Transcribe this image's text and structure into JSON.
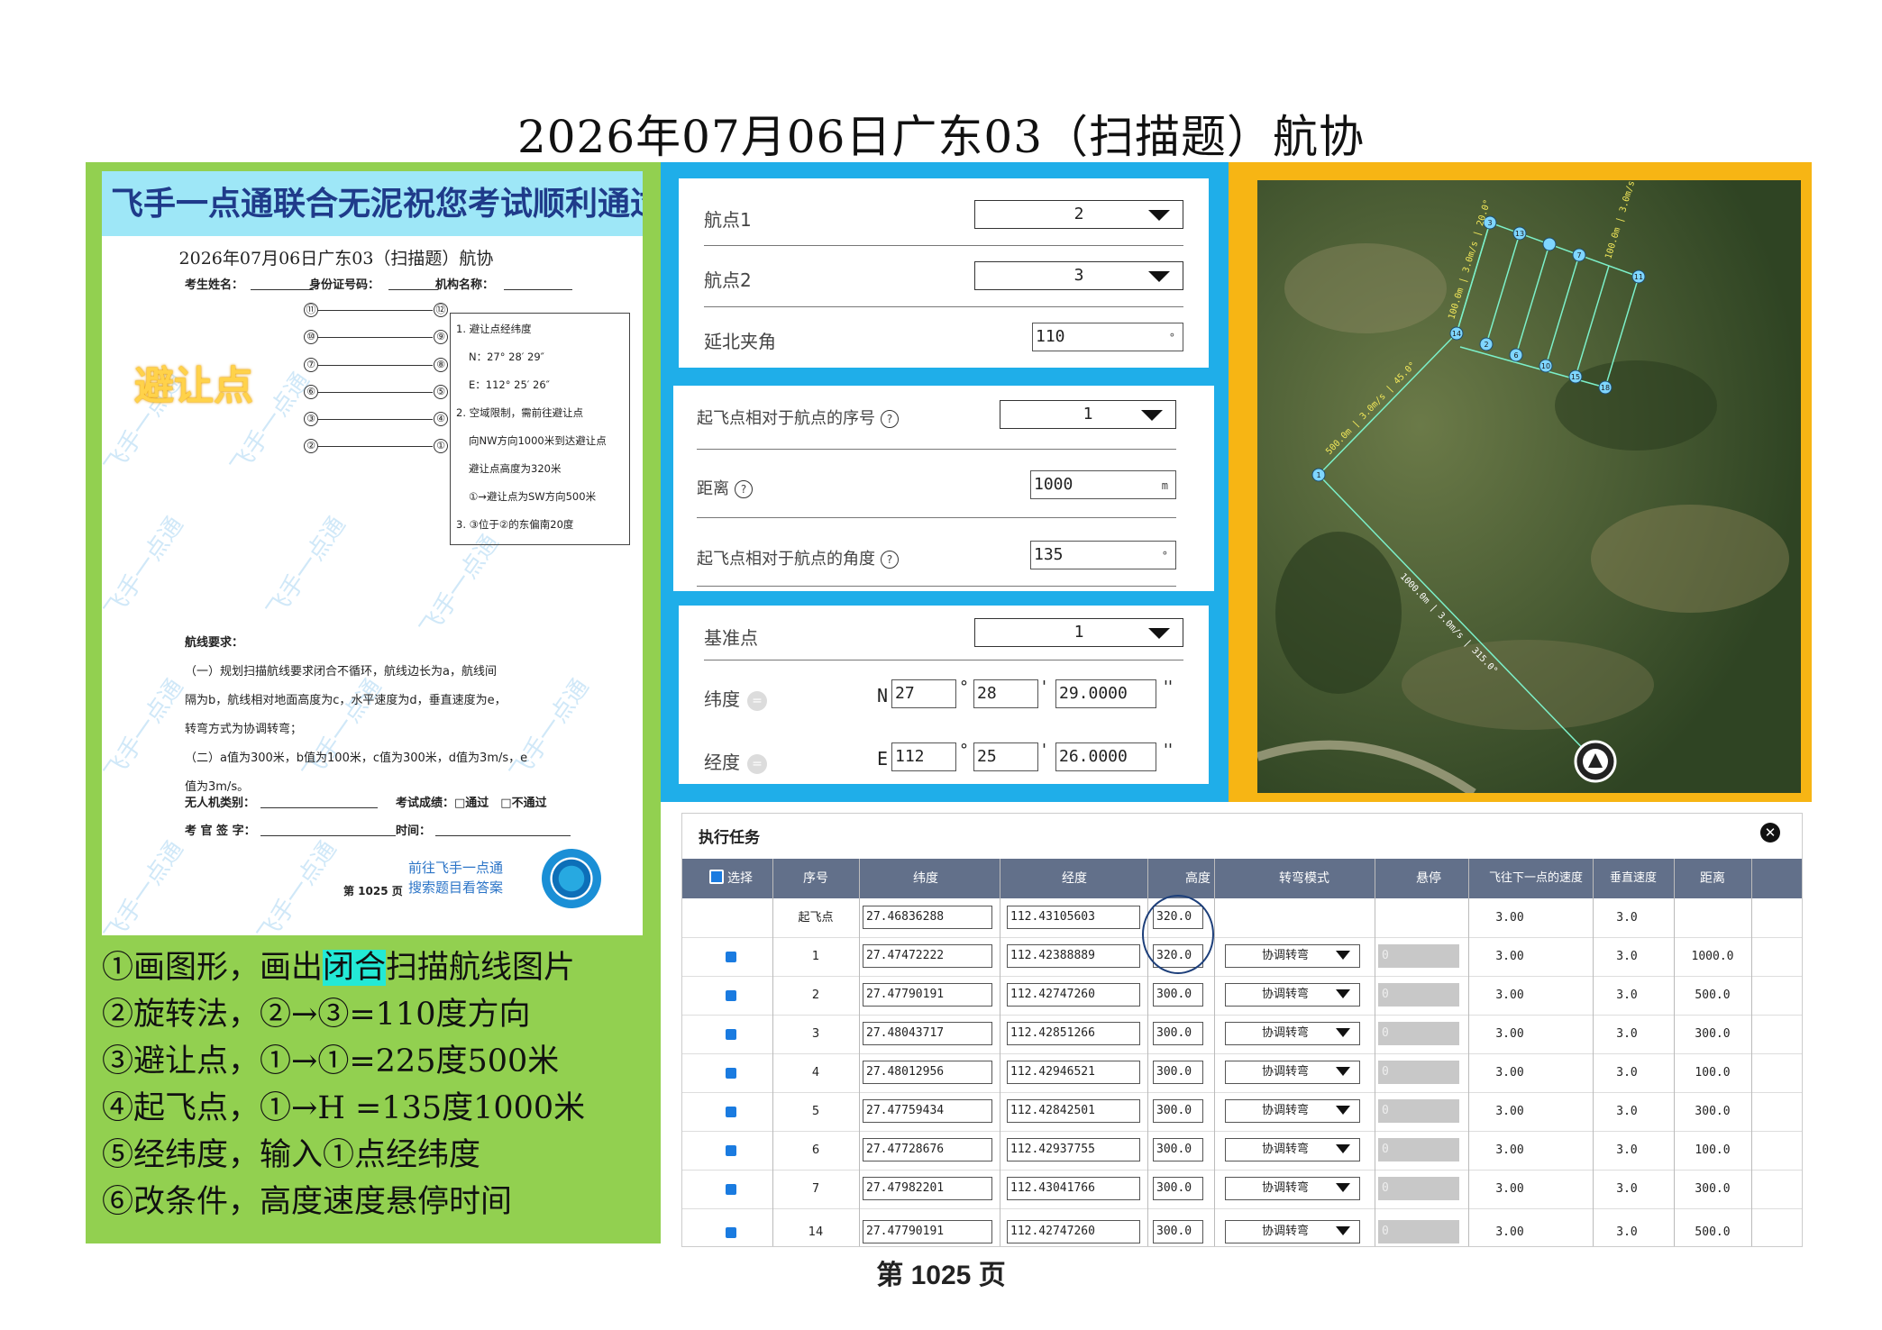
{
  "page_title": "2026年07月06日广东03（扫描题）航协",
  "paper": {
    "banner": "飞手一点通联合无泥祝您考试顺利通过",
    "title": "2026年07月06日广东03（扫描题）航协",
    "meta": {
      "name": "考生姓名：",
      "id": "身份证号码：",
      "org": "机构名称："
    },
    "avoid_label": "避让点",
    "nodes": {
      "n1": "①",
      "n2": "②",
      "n3": "③",
      "n4": "④",
      "n5": "⑤",
      "n6": "⑥",
      "n7": "⑦",
      "n8": "⑧",
      "n9": "⑨",
      "n10": "⑩",
      "n11": "⑪",
      "n12": "⑫"
    },
    "notes": [
      "1. 避让点经纬度",
      "N：27° 28′ 29″",
      "E：112° 25′ 26″",
      "2. 空域限制，需前往避让点",
      "向NW方向1000米到达避让点",
      "避让点高度为320米",
      "①→避让点为SW方向500米",
      "3. ③位于②的东偏南20度"
    ],
    "route_req": {
      "heading": "航线要求：",
      "lines": [
        "（一）规划扫描航线要求闭合不循环，航线边长为a，航线间",
        "隔为b，航线相对地面高度为c，水平速度为d，垂直速度为e，",
        "转弯方式为协调转弯；",
        "（二）a值为300米，b值为100米，c值为300米，d值为3m/s，e",
        "值为3m/s。"
      ]
    },
    "sign": {
      "drone_type": "无人机类别：",
      "result": "考试成绩：□通过　□不通过",
      "examiner": "考 官 签 字：",
      "time": "时间："
    },
    "footer_link_1": "前往飞手一点通",
    "footer_link_2": "搜索题目看答案",
    "page_num": "第 1025 页",
    "watermark": "飞手一点通"
  },
  "steps": {
    "s1_pre": "①画图形，画出",
    "s1_hl": "闭合",
    "s1_post": "扫描航线图片",
    "s2": "②旋转法，②→③=110度方向",
    "s3": "③避让点，①→①=225度500米",
    "s4": "④起飞点，①→H =135度1000米",
    "s5": "⑤经纬度，输入①点经纬度",
    "s6": "⑥改条件，高度速度悬停时间"
  },
  "form": {
    "wp1_label": "航点1",
    "wp1_value": "2",
    "wp2_label": "航点2",
    "wp2_value": "3",
    "angle_label": "延北夹角",
    "angle_value": "110",
    "angle_unit": "°",
    "takeoff_seq_label": "起飞点相对于航点的序号",
    "takeoff_seq_value": "1",
    "distance_label": "距离",
    "distance_value": "1000",
    "distance_unit": "m",
    "takeoff_angle_label": "起飞点相对于航点的角度",
    "takeoff_angle_value": "135",
    "takeoff_angle_unit": "°",
    "help": "?",
    "base_label": "基准点",
    "base_value": "1",
    "lat_label": "纬度",
    "lat_dir": "N",
    "lat_deg": "27",
    "lat_min": "28",
    "lat_sec": "29.0000",
    "lon_label": "经度",
    "lon_dir": "E",
    "lon_deg": "112",
    "lon_min": "25",
    "lon_sec": "26.0000",
    "deg_sym": "°",
    "min_sym": "'",
    "sec_sym": "''"
  },
  "map": {
    "labels": {
      "seg_top": "100.0m | 3.0m/s | 20.0°",
      "seg_right": "100.0m | 3.0m/s | 110.0°",
      "seg_avoid": "500.0m | 3.0m/s | 45.0°",
      "seg_takeoff": "1000.0m | 3.0m/s | 315.0°"
    },
    "wp_labels": {
      "w1": "1",
      "w2": "2",
      "w3": "3",
      "w6": "6",
      "w7": "7",
      "w10": "10",
      "w11": "11",
      "w13": "13",
      "w14": "14",
      "w15": "15",
      "w18": "18"
    },
    "colors": {
      "route": "#7cf0c9",
      "label": "#f3e85a"
    }
  },
  "task": {
    "title": "执行任务",
    "close": "✕",
    "headers": {
      "select": "选择",
      "seq": "序号",
      "lat": "纬度",
      "lon": "经度",
      "alt": "高度",
      "turn": "转弯模式",
      "hover": "悬停",
      "speed": "飞往下一点的速度",
      "vspeed": "垂直速度",
      "dist": "距离"
    },
    "rows": [
      {
        "seq": "起飞点",
        "lat": "27.46836288",
        "lon": "112.43105603",
        "alt": "320.0",
        "turn": "",
        "hover": "",
        "speed": "3.00",
        "vspeed": "3.0",
        "dist": ""
      },
      {
        "seq": "1",
        "lat": "27.47472222",
        "lon": "112.42388889",
        "alt": "320.0",
        "turn": "协调转弯",
        "hover": "0",
        "speed": "3.00",
        "vspeed": "3.0",
        "dist": "1000.0"
      },
      {
        "seq": "2",
        "lat": "27.47790191",
        "lon": "112.42747260",
        "alt": "300.0",
        "turn": "协调转弯",
        "hover": "0",
        "speed": "3.00",
        "vspeed": "3.0",
        "dist": "500.0"
      },
      {
        "seq": "3",
        "lat": "27.48043717",
        "lon": "112.42851266",
        "alt": "300.0",
        "turn": "协调转弯",
        "hover": "0",
        "speed": "3.00",
        "vspeed": "3.0",
        "dist": "300.0"
      },
      {
        "seq": "4",
        "lat": "27.48012956",
        "lon": "112.42946521",
        "alt": "300.0",
        "turn": "协调转弯",
        "hover": "0",
        "speed": "3.00",
        "vspeed": "3.0",
        "dist": "100.0"
      },
      {
        "seq": "5",
        "lat": "27.47759434",
        "lon": "112.42842501",
        "alt": "300.0",
        "turn": "协调转弯",
        "hover": "0",
        "speed": "3.00",
        "vspeed": "3.0",
        "dist": "300.0"
      },
      {
        "seq": "6",
        "lat": "27.47728676",
        "lon": "112.42937755",
        "alt": "300.0",
        "turn": "协调转弯",
        "hover": "0",
        "speed": "3.00",
        "vspeed": "3.0",
        "dist": "100.0"
      },
      {
        "seq": "7",
        "lat": "27.47982201",
        "lon": "112.43041766",
        "alt": "300.0",
        "turn": "协调转弯",
        "hover": "0",
        "speed": "3.00",
        "vspeed": "3.0",
        "dist": "300.0"
      },
      {
        "seq": "14",
        "lat": "27.47790191",
        "lon": "112.42747260",
        "alt": "300.0",
        "turn": "协调转弯",
        "hover": "0",
        "speed": "3.00",
        "vspeed": "3.0",
        "dist": "500.0"
      }
    ]
  },
  "page_bottom": "第 1025 页"
}
